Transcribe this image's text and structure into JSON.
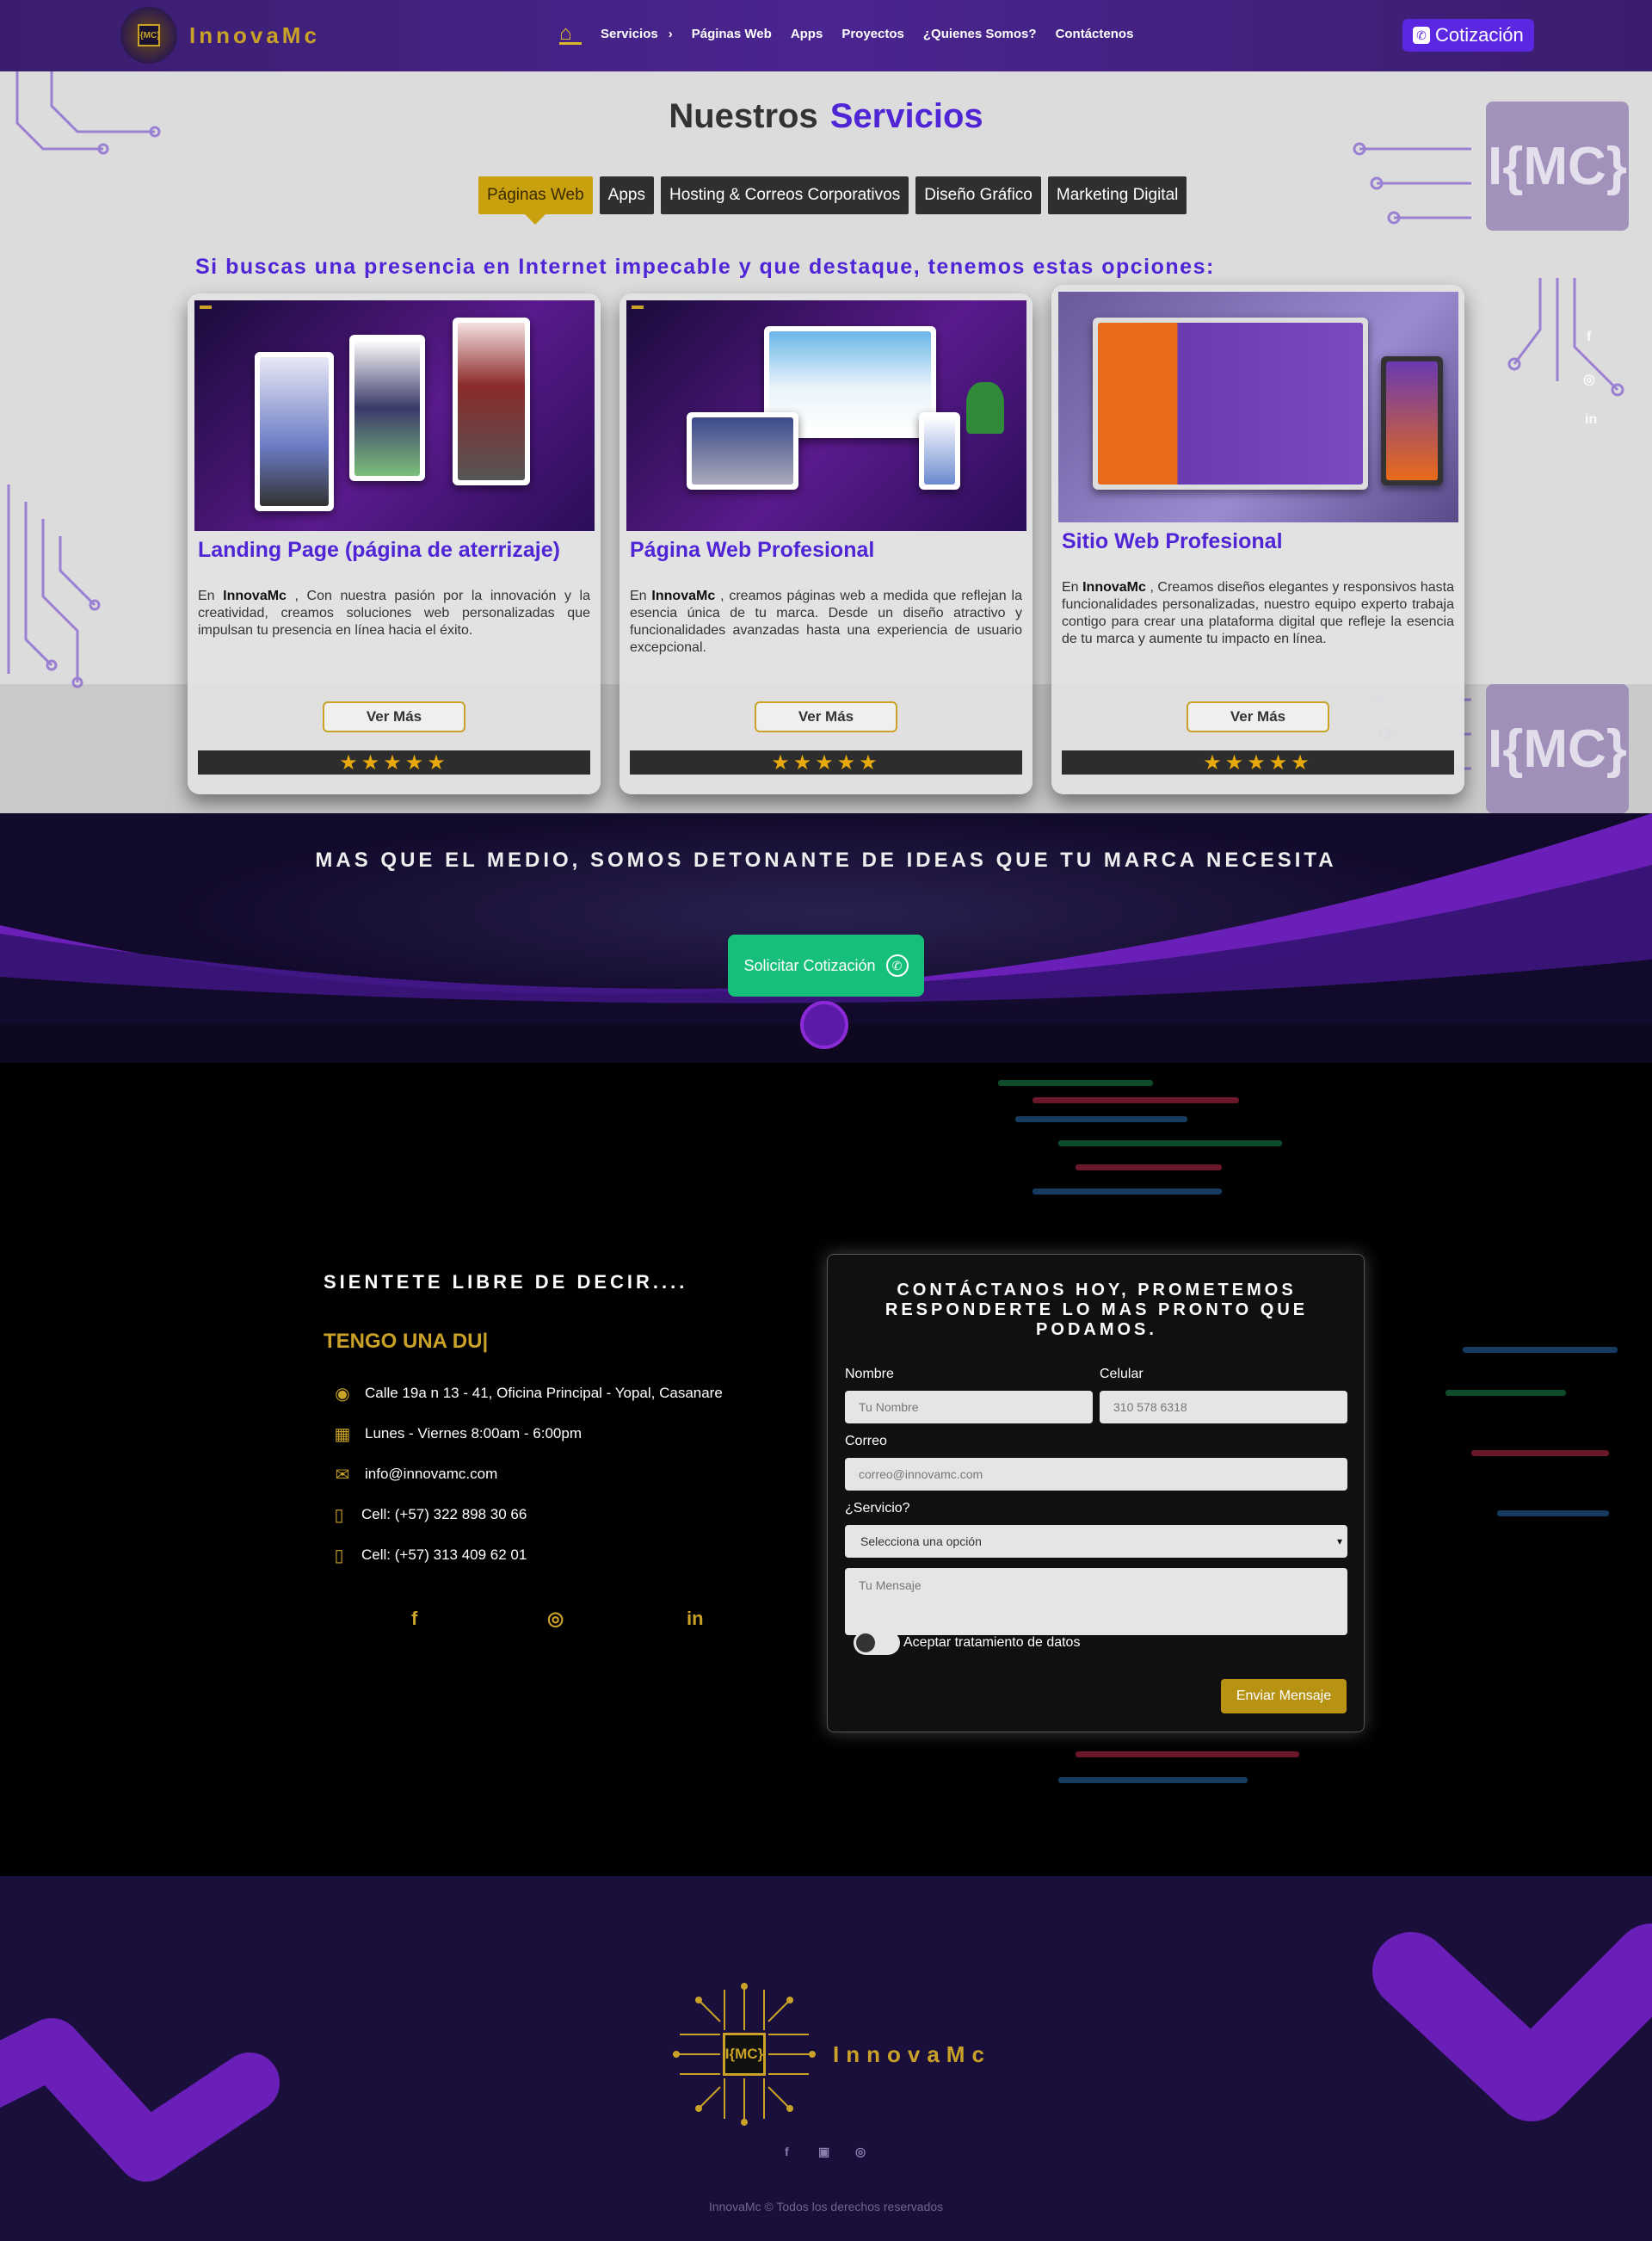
{
  "nav": {
    "brand": "InnovaMc",
    "brand_chip": "I{MC}",
    "home_icon": "home-icon",
    "items": [
      {
        "label": "Servicios",
        "caret": "›"
      },
      {
        "label": "Páginas Web"
      },
      {
        "label": "Apps"
      },
      {
        "label": "Proyectos"
      },
      {
        "label": "¿Quienes Somos?"
      },
      {
        "label": "Contáctenos"
      }
    ],
    "cta": "Cotización"
  },
  "services": {
    "title_1": "Nuestros",
    "title_2": "Servicios",
    "tabs": [
      "Páginas Web",
      "Apps",
      "Hosting & Correos Corporativos",
      "Diseño Gráfico",
      "Marketing Digital"
    ],
    "active_tab": 0,
    "tagline": "Si buscas una presencia en Internet impecable y que destaque, tenemos estas opciones:",
    "chip_logo": "I{MC}",
    "cards": [
      {
        "title": "Landing Page (página de aterrizaje)",
        "brand": "InnovaMc",
        "pre": "En",
        "text": ", Con nuestra pasión por la innovación y la creatividad, creamos soluciones web personalizadas que impulsan tu presencia en línea hacia el éxito.",
        "button": "Ver Más",
        "rating": "★★★★★"
      },
      {
        "title": "Página Web Profesional",
        "brand": "InnovaMc",
        "pre": "En",
        "text": ", creamos páginas web a medida que reflejan la esencia única de tu marca. Desde un diseño atractivo y funcionalidades avanzadas hasta una experiencia de usuario excepcional.",
        "button": "Ver Más",
        "rating": "★★★★★"
      },
      {
        "title": "Sitio Web Profesional",
        "brand": "InnovaMc",
        "pre": "En",
        "text": ", Creamos diseños elegantes y responsivos hasta funcionalidades personalizadas, nuestro equipo experto trabaja contigo para crear una plataforma digital que refleje la esencia de tu marca y aumente tu impacto en línea.",
        "button": "Ver Más",
        "rating": "★★★★★"
      }
    ],
    "side_social": [
      "f",
      "◎",
      "in"
    ]
  },
  "banner": {
    "slogan": "MAS QUE EL MEDIO, SOMOS DETONANTE DE IDEAS QUE TU MARCA NECESITA",
    "cta": "Solicitar Cotización"
  },
  "contact": {
    "title": "SIENTETE LIBRE DE DECIR....",
    "typewriter": "TENGO UNA DU|",
    "info": [
      {
        "icon": "location-icon",
        "glyph": "◉",
        "text": "Calle 19a n 13 - 41, Oficina Principal - Yopal, Casanare"
      },
      {
        "icon": "calendar-icon",
        "glyph": "▦",
        "text": "Lunes - Viernes 8:00am - 6:00pm"
      },
      {
        "icon": "mail-icon",
        "glyph": "✉",
        "text": "info@innovamc.com"
      },
      {
        "icon": "phone-icon",
        "glyph": "▯",
        "text": "Cell: (+57) 322 898 30 66"
      },
      {
        "icon": "phone-icon",
        "glyph": "▯",
        "text": "Cell: (+57) 313 409 62 01"
      }
    ],
    "social": [
      "f",
      "◎",
      "in"
    ],
    "form": {
      "title": "CONTÁCTANOS HOY, PROMETEMOS RESPONDERTE LO MAS PRONTO QUE PODAMOS.",
      "name_label": "Nombre",
      "name_placeholder": "Tu Nombre",
      "phone_label": "Celular",
      "phone_placeholder": "310 578 6318",
      "email_label": "Correo",
      "email_placeholder": "correo@innovamc.com",
      "service_label": "¿Servicio?",
      "service_value": "Selecciona una opción",
      "message_placeholder": "Tu Mensaje",
      "consent": "Aceptar tratamiento de datos",
      "submit": "Enviar Mensaje"
    }
  },
  "footer": {
    "logo_text": "I{MC}",
    "brand": "InnovaMc",
    "social": [
      "f",
      "▣",
      "◎"
    ],
    "copyright": "InnovaMc © Todos los derechos reservados"
  }
}
